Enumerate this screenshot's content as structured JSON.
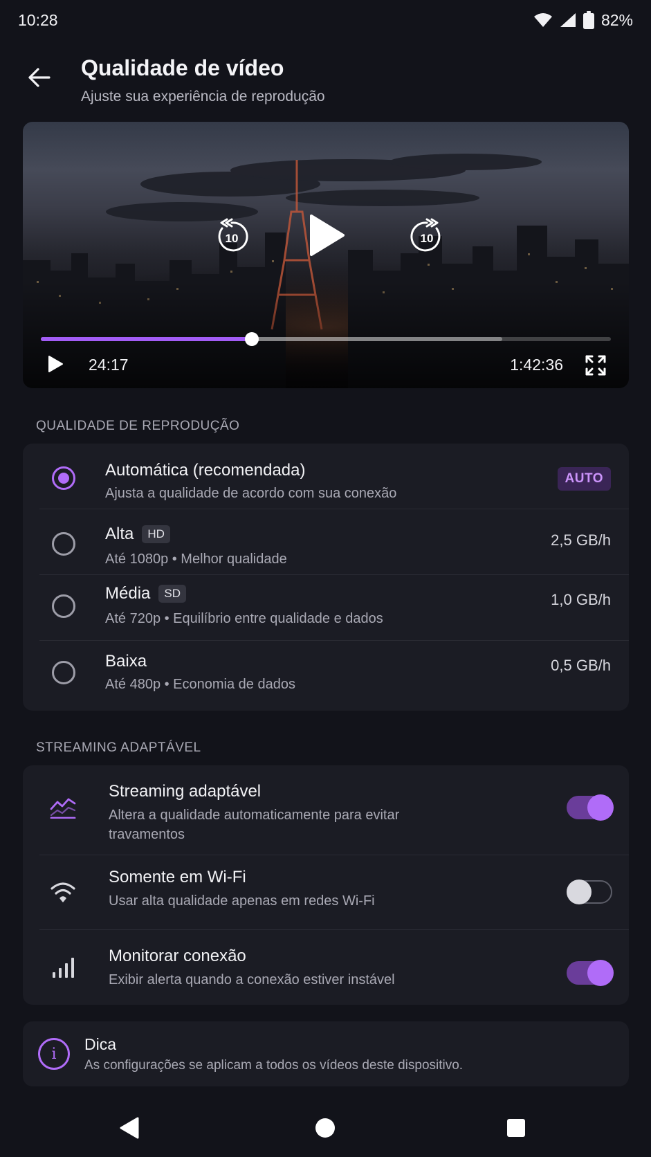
{
  "status_bar": {
    "time": "10:28",
    "battery": "82%",
    "icons": [
      "wifi-icon",
      "signal-icon",
      "battery-icon"
    ]
  },
  "header": {
    "back_icon": "arrow-left-icon",
    "title": "Qualidade de vídeo",
    "subtitle": "Ajuste sua experiência de reprodução"
  },
  "player": {
    "current_time": "24:17",
    "total_time": "1:42:36",
    "progress_fraction": 0.37,
    "buffered_fraction": 0.81,
    "rewind_seconds": "10",
    "forward_seconds": "10",
    "controls": [
      "rewind-10-icon",
      "play-icon",
      "forward-10-icon",
      "fullscreen-icon"
    ]
  },
  "quality": {
    "section_label": "QUALIDADE DE REPRODUÇÃO",
    "selected": "auto",
    "options": [
      {
        "id": "auto",
        "title": "Automática (recomendada)",
        "description": "Ajusta a qualidade de acordo com sua conexão",
        "badge": "AUTO",
        "rate": ""
      },
      {
        "id": "alta",
        "title": "Alta",
        "tag": "HD",
        "description": "Até 1080p • Melhor qualidade",
        "rate": "2,5 GB/h"
      },
      {
        "id": "media",
        "title": "Média",
        "tag": "SD",
        "description": "Até 720p • Equilíbrio entre qualidade e dados",
        "rate": "1,0 GB/h"
      },
      {
        "id": "baixa",
        "title": "Baixa",
        "description": "Até 480p • Economia de dados",
        "rate": "0,5 GB/h"
      }
    ]
  },
  "streaming": {
    "section_label": "STREAMING ADAPTÁVEL",
    "settings": [
      {
        "title": "Streaming adaptável",
        "description": "Altera a qualidade automaticamente para evitar travamentos",
        "enabled": true,
        "icon": "trending-chart-icon"
      },
      {
        "title": "Somente em Wi-Fi",
        "description": "Usar alta qualidade apenas em redes Wi-Fi",
        "enabled": false,
        "icon": "wifi-icon"
      },
      {
        "title": "Monitorar conexão",
        "description": "Exibir alerta quando a conexão estiver instável",
        "enabled": true,
        "icon": "signal-bars-icon"
      }
    ]
  },
  "tip": {
    "icon": "info-icon",
    "icon_glyph": "i",
    "title": "Dica",
    "text": "As configurações se aplicam a todos os vídeos deste dispositivo."
  },
  "nav": {
    "icons": [
      "nav-back-icon",
      "nav-home-icon",
      "nav-recents-icon"
    ]
  },
  "colors": {
    "accent": "#b06cf8",
    "background": "#12131a",
    "card": "#1b1c24"
  }
}
